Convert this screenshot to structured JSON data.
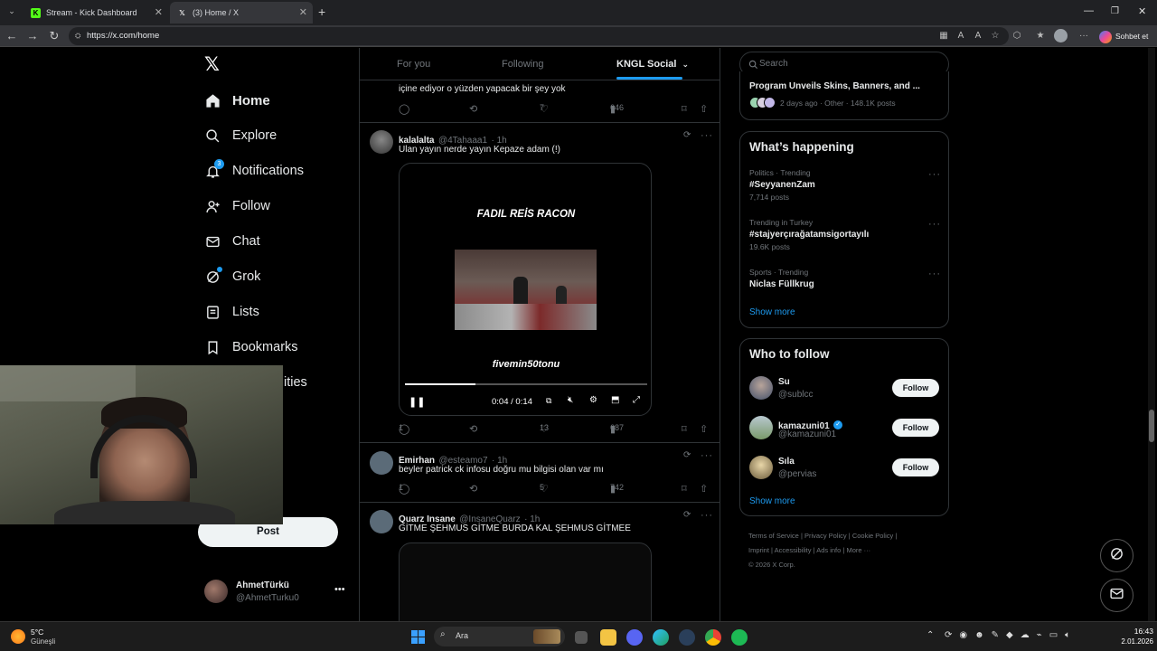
{
  "browser": {
    "tabs": [
      {
        "title": "Stream - Kick Dashboard"
      },
      {
        "title": "(3) Home / X"
      }
    ],
    "url": "https://x.com/home",
    "profile_button": "Sohbet et"
  },
  "sidebar": {
    "logo": "𝕏",
    "items": [
      {
        "label": "Home",
        "icon": "home-icon"
      },
      {
        "label": "Explore",
        "icon": "search-icon"
      },
      {
        "label": "Notifications",
        "icon": "bell-icon",
        "badge": "3"
      },
      {
        "label": "Follow",
        "icon": "person-add-icon"
      },
      {
        "label": "Chat",
        "icon": "mail-icon"
      },
      {
        "label": "Grok",
        "icon": "grok-icon"
      },
      {
        "label": "Lists",
        "icon": "list-icon"
      },
      {
        "label": "Bookmarks",
        "icon": "bookmark-icon"
      },
      {
        "label": "ities",
        "icon": "communities-icon"
      }
    ],
    "post_button": "Post",
    "account": {
      "name": "AhmetTürkü",
      "handle": "@AhmetTurku0"
    }
  },
  "timeline": {
    "tabs": [
      "For you",
      "Following",
      "KNGL Social"
    ],
    "partial_tweet": {
      "text": "içine ediyor o yüzden yapacak bir şey yok",
      "views": "646",
      "likes": "7"
    },
    "tweets": [
      {
        "name": "kalalalta",
        "handle": "@4Tahaaa1",
        "time": "· 1h",
        "text": "Ulan  yayın nerde yayın Kepaze adam (!)",
        "video": {
          "title": "FADIL REİS RACON",
          "caption": "fivemin50tonu",
          "time": "0:04 / 0:14",
          "progress": 0.29
        },
        "replies": "1",
        "likes": "13",
        "views": "687"
      },
      {
        "name": "Emirhan",
        "handle": "@esteamo7",
        "time": "· 1h",
        "text": "beyler patrick ck infosu doğru mu bilgisi olan var mı",
        "replies": "1",
        "likes": "5",
        "views": "742"
      },
      {
        "name": "Quarz Insane",
        "handle": "@InsaneQuarz",
        "time": "· 1h",
        "text": "GİTME ŞEHMUS GİTME BURDA KAL ŞEHMUS GİTMEE"
      }
    ]
  },
  "right": {
    "search_placeholder": "Search",
    "top_card": {
      "title": "Program Unveils Skins, Banners, and ...",
      "meta": "2 days ago · Other · 148.1K posts"
    },
    "happening": {
      "title": "What’s happening",
      "trends": [
        {
          "meta": "Politics · Trending",
          "name": "#SeyyanenZam",
          "posts": "7,714 posts"
        },
        {
          "meta": "Trending in Turkey",
          "name": "#stajyerçırağatamsigortayılı",
          "posts": "19.6K posts"
        },
        {
          "meta": "Sports · Trending",
          "name": "Niclas Füllkrug",
          "posts": ""
        }
      ],
      "show_more": "Show more"
    },
    "who_to_follow": {
      "title": "Who to follow",
      "users": [
        {
          "name": "Su",
          "handle": "@sublcc",
          "button": "Follow"
        },
        {
          "name": "kamazuni01",
          "handle": "@kamazuni01",
          "button": "Follow",
          "verified": true
        },
        {
          "name": "Sıla",
          "handle": "@pervias",
          "button": "Follow"
        }
      ],
      "show_more": "Show more"
    },
    "footer": {
      "line1": [
        "Terms of Service",
        "Privacy Policy",
        "Cookie Policy"
      ],
      "line2": [
        "Imprint",
        "Accessibility",
        "Ads info",
        "More ···"
      ],
      "copyright": "© 2026 X Corp."
    }
  },
  "taskbar": {
    "weather_temp": "5°C",
    "weather_desc": "Güneşli",
    "search_label": "Ara",
    "time": "16:43",
    "date": "2.01.2026"
  },
  "colors": {
    "accent": "#1d9bf0",
    "kick_green": "#53fc18"
  }
}
